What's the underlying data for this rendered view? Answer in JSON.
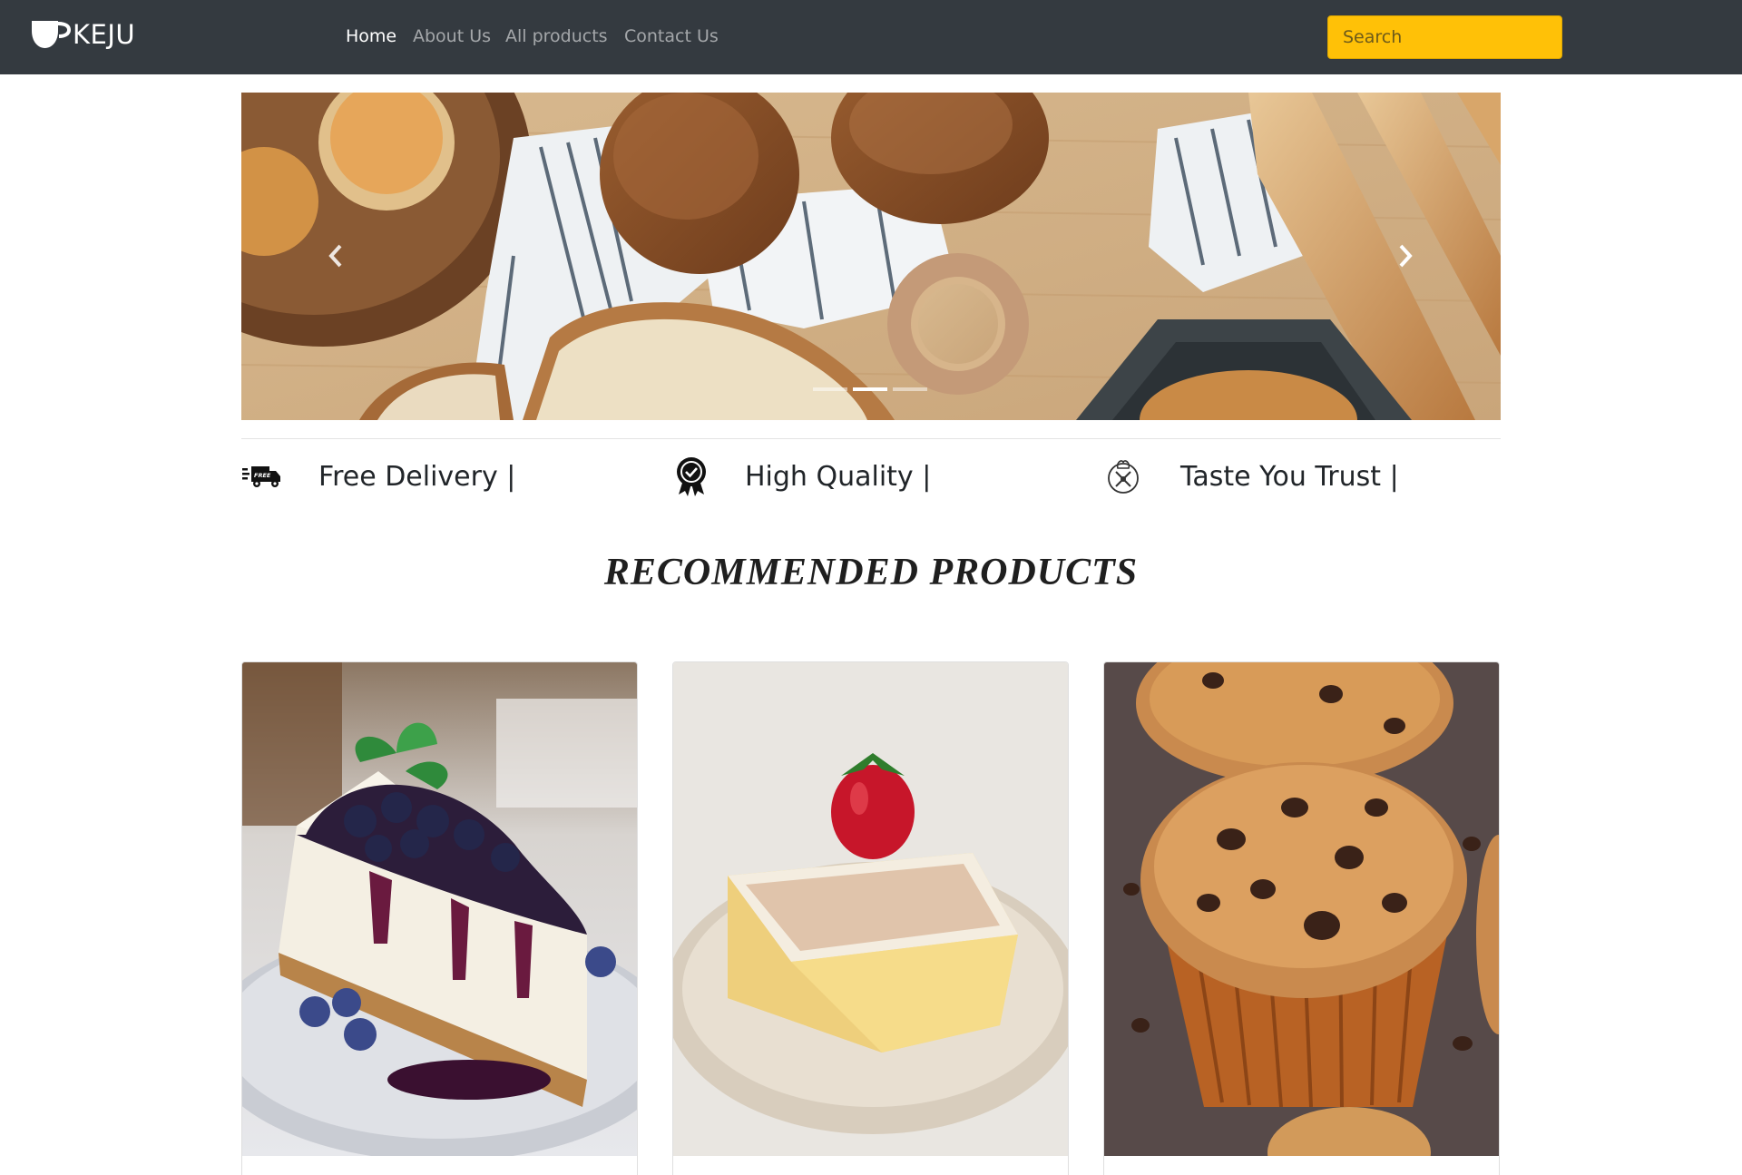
{
  "brand": {
    "name": "KEJU",
    "logo_icon": "cup-icon"
  },
  "nav": {
    "items": [
      {
        "label": "Home",
        "active": true
      },
      {
        "label": "About Us",
        "active": false
      },
      {
        "label": "All products",
        "active": false
      },
      {
        "label": "Contact Us",
        "active": false
      }
    ]
  },
  "search": {
    "placeholder": "Search",
    "value": ""
  },
  "carousel": {
    "image": "bread-loaves-photo",
    "slide_count": 3,
    "active_slide": 2,
    "prev_icon": "chevron-left-icon",
    "next_icon": "chevron-right-icon"
  },
  "features": [
    {
      "label": "Free Delivery |",
      "icon": "delivery-truck-icon",
      "badge": "FREE"
    },
    {
      "label": "High Quality |",
      "icon": "quality-badge-icon"
    },
    {
      "label": "Taste You Trust |",
      "icon": "chef-emblem-icon"
    }
  ],
  "recommended": {
    "title": "RECOMMENDED PRODUCTS",
    "products": [
      {
        "image": "blueberry-cheesecake-photo"
      },
      {
        "image": "tres-leches-cake-photo"
      },
      {
        "image": "chocolate-chip-muffin-photo"
      }
    ]
  },
  "colors": {
    "navbar": "#343a40",
    "search_bg": "#ffc107",
    "text_dark": "#212529"
  }
}
